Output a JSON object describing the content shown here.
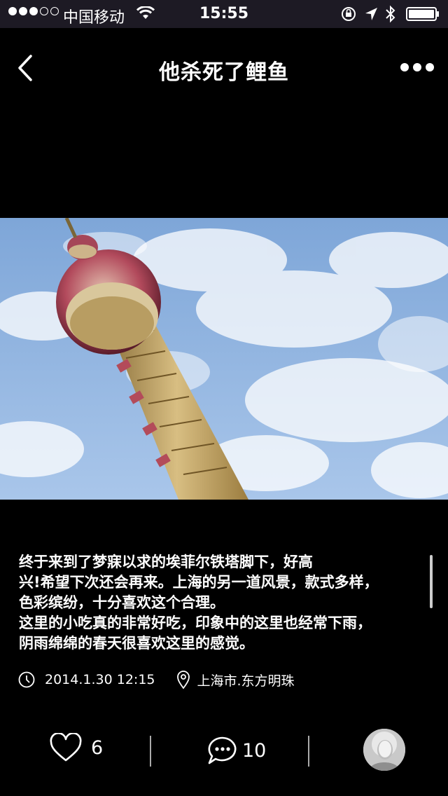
{
  "status_bar": {
    "carrier": "中国移动",
    "time": "15:55",
    "signal_bars_filled": 3,
    "signal_bars_total": 5,
    "icons": [
      "wifi-icon",
      "orientation-lock-icon",
      "location-arrow-icon",
      "bluetooth-icon",
      "battery-icon"
    ]
  },
  "nav": {
    "title": "他杀死了鲤鱼",
    "back_icon": "chevron-left-icon",
    "more_icon": "more-dots-icon"
  },
  "post": {
    "description_lines": [
      "终于来到了梦寐以求的埃菲尔铁塔脚下，好高",
      "兴!希望下次还会再来。上海的另一道风景，款式多样，",
      "色彩缤纷，十分喜欢这个合理。",
      "这里的小吃真的非常好吃，印象中的这里也经常下雨，",
      "阴雨绵绵的春天很喜欢这里的感觉。"
    ],
    "datetime": "2014.1.30 12:15",
    "location": "上海市.东方明珠"
  },
  "toolbar": {
    "likes": "6",
    "comments": "10"
  },
  "colors": {
    "background": "#000000",
    "status_bar": "#1d1a24",
    "text": "#ffffff",
    "divider": "#aaaaaa"
  }
}
